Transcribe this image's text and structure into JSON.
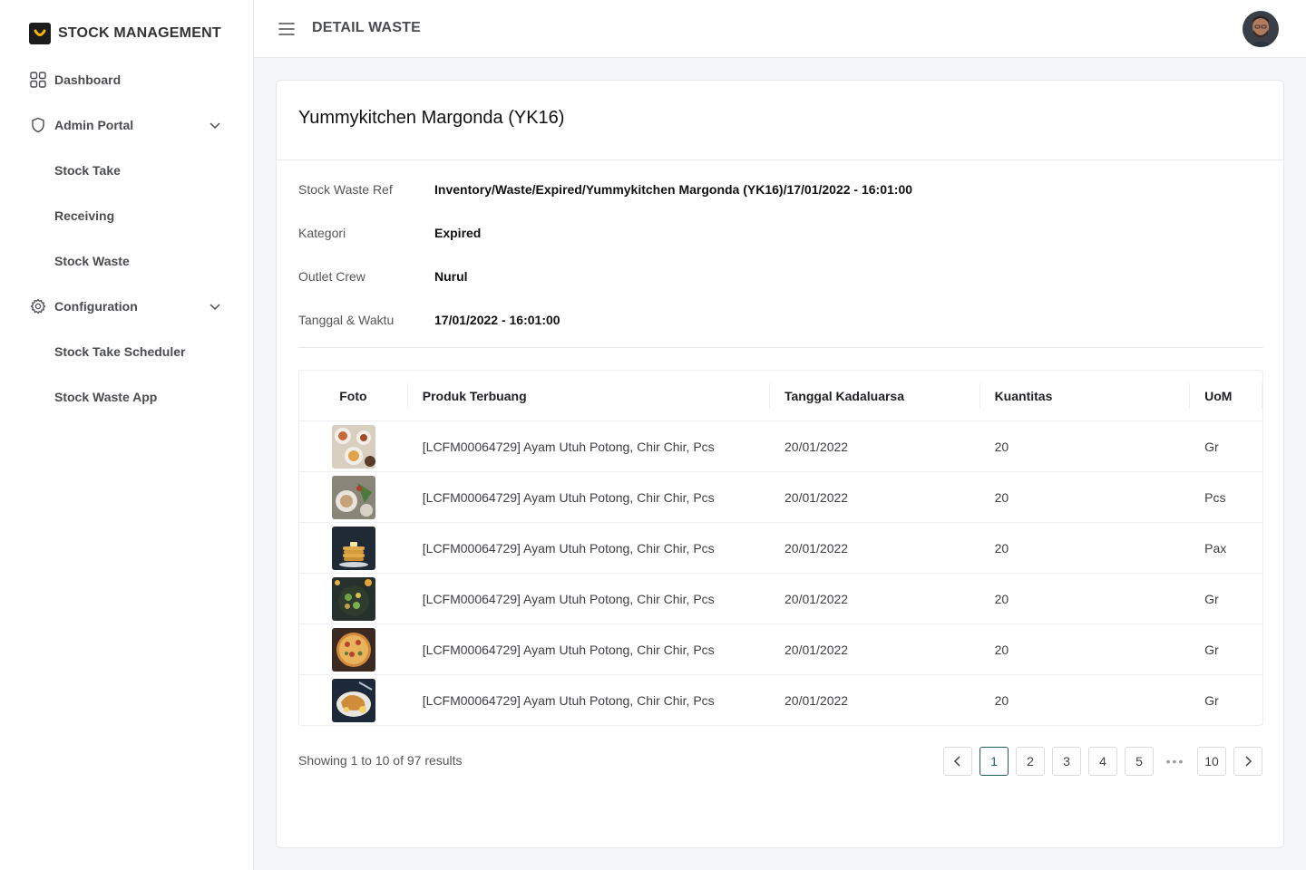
{
  "brand": {
    "title": "STOCK MANAGEMENT",
    "logo_icon": "smile-logo-icon"
  },
  "sidebar": {
    "items": [
      {
        "label": "Dashboard",
        "icon": "grid-icon"
      },
      {
        "label": "Admin Portal",
        "icon": "shield-icon",
        "expanded": true
      },
      {
        "label": "Stock Take"
      },
      {
        "label": "Receiving"
      },
      {
        "label": "Stock Waste"
      },
      {
        "label": "Configuration",
        "icon": "gear-icon",
        "expanded": true
      },
      {
        "label": "Stock Take Scheduler"
      },
      {
        "label": "Stock Waste App"
      }
    ]
  },
  "header": {
    "title": "DETAIL WASTE",
    "menu_icon": "hamburger-icon",
    "avatar_icon": "user-avatar"
  },
  "detail": {
    "title": "Yummykitchen Margonda (YK16)",
    "fields": [
      {
        "label": "Stock Waste Ref",
        "value": "Inventory/Waste/Expired/Yummykitchen Margonda (YK16)/17/01/2022 - 16:01:00"
      },
      {
        "label": "Kategori",
        "value": "Expired"
      },
      {
        "label": "Outlet Crew",
        "value": "Nurul"
      },
      {
        "label": "Tanggal & Waktu",
        "value": "17/01/2022 - 16:01:00"
      }
    ]
  },
  "table": {
    "headers": [
      "Foto",
      "Produk Terbuang",
      "Tanggal Kadaluarsa",
      "Kuantitas",
      "UoM"
    ],
    "rows": [
      {
        "product": "[LCFM00064729] Ayam Utuh Potong, Chir Chir, Pcs",
        "expiry": "20/01/2022",
        "qty": "20",
        "uom": "Gr"
      },
      {
        "product": "[LCFM00064729] Ayam Utuh Potong, Chir Chir, Pcs",
        "expiry": "20/01/2022",
        "qty": "20",
        "uom": "Pcs"
      },
      {
        "product": "[LCFM00064729] Ayam Utuh Potong, Chir Chir, Pcs",
        "expiry": "20/01/2022",
        "qty": "20",
        "uom": "Pax"
      },
      {
        "product": "[LCFM00064729] Ayam Utuh Potong, Chir Chir, Pcs",
        "expiry": "20/01/2022",
        "qty": "20",
        "uom": "Gr"
      },
      {
        "product": "[LCFM00064729] Ayam Utuh Potong, Chir Chir, Pcs",
        "expiry": "20/01/2022",
        "qty": "20",
        "uom": "Gr"
      },
      {
        "product": "[LCFM00064729] Ayam Utuh Potong, Chir Chir, Pcs",
        "expiry": "20/01/2022",
        "qty": "20",
        "uom": "Gr"
      }
    ]
  },
  "pagination": {
    "summary": "Showing 1 to 10 of 97 results",
    "pages": [
      "1",
      "2",
      "3",
      "4",
      "5"
    ],
    "ellipsis": "•••",
    "last": "10",
    "active": "1",
    "accent": "#1f5e5a"
  }
}
